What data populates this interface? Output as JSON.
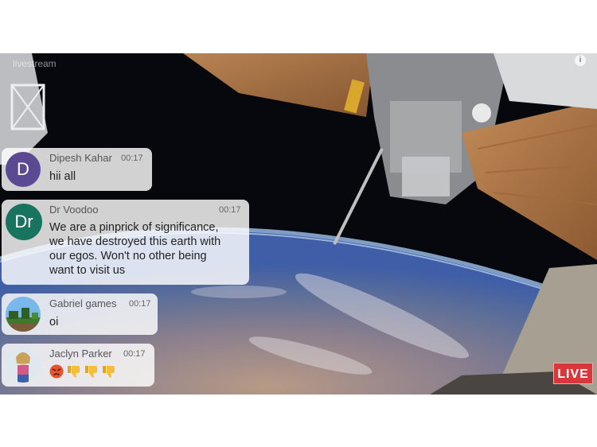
{
  "stream": {
    "watermark": "livestream",
    "watermark_sub": "",
    "corner_icon": "i",
    "live_label": "LIVE"
  },
  "messages": [
    {
      "name": "Dipesh Kahar",
      "time": "00:17",
      "text": "hii all",
      "avatar": {
        "type": "letter",
        "letter": "D",
        "color": "#5b4a93"
      }
    },
    {
      "name": "Dr Voodoo",
      "time": "00:17",
      "lines": [
        "We are a pinprick of significance,",
        "we have destroyed this earth with",
        "our egos. Won't no other being",
        "want to visit us"
      ],
      "avatar": {
        "type": "letter",
        "letter": "Dr",
        "color": "#18735f"
      }
    },
    {
      "name": "Gabriel games",
      "time": "00:17",
      "text": "oi",
      "avatar": {
        "type": "image",
        "icon": "landscape-avatar-icon"
      }
    },
    {
      "name": "Jaclyn Parker",
      "time": "00:17",
      "emojis": [
        "angry-face-emoji",
        "thumbs-down-emoji",
        "thumbs-down-emoji",
        "thumbs-down-emoji"
      ],
      "avatar": {
        "type": "image",
        "icon": "person-avatar-icon"
      }
    }
  ]
}
